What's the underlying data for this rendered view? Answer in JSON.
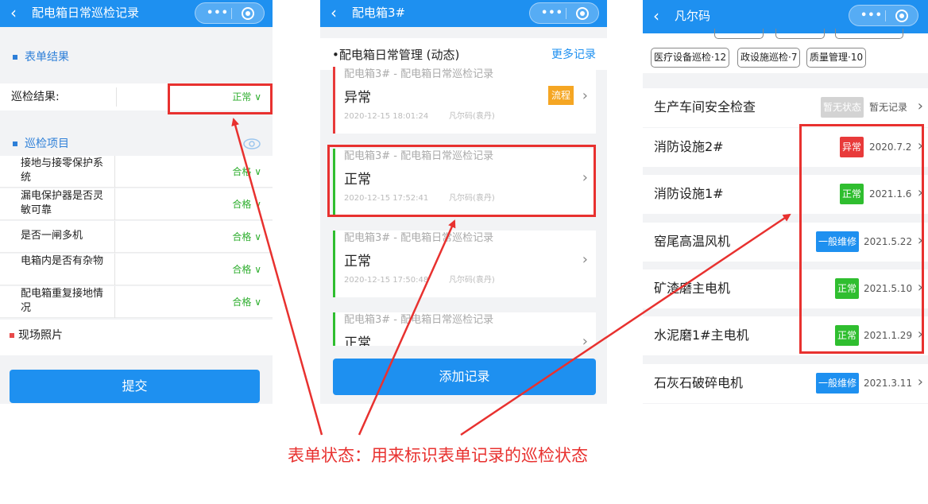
{
  "colors": {
    "nav": "#1e90f0",
    "ok": "#2fae2f",
    "bad": "#e83a3a",
    "orange": "#f5a623",
    "annot": "#e8312f"
  },
  "capsule": {
    "dots": "•••"
  },
  "p1": {
    "title": "配电箱日常巡检记录",
    "sec_result": "表单结果",
    "result_label": "巡检结果:",
    "result_value": "正常",
    "sec_items": "巡检项目",
    "items": [
      {
        "label": "接地与接零保护系统",
        "value": "合格"
      },
      {
        "label": "漏电保护器是否灵敏可靠",
        "value": "合格"
      },
      {
        "label": "是否一闸多机",
        "value": "合格"
      },
      {
        "label": "电箱内是否有杂物",
        "value": "合格"
      },
      {
        "label": "配电箱重复接地情况",
        "value": "合格"
      }
    ],
    "photos": "现场照片",
    "submit": "提交"
  },
  "p2": {
    "title": "配电箱3#",
    "section": "•配电箱日常管理 (动态)",
    "more": "更多记录",
    "cards": [
      {
        "title": "配电箱3# - 配电箱日常巡检记录",
        "status": "异常",
        "date": "2020-12-15 18:01:24",
        "user": "凡尔码(袁丹)",
        "flow": "流程"
      },
      {
        "title": "配电箱3# - 配电箱日常巡检记录",
        "status": "正常",
        "date": "2020-12-15 17:52:41",
        "user": "凡尔码(袁丹)"
      },
      {
        "title": "配电箱3# - 配电箱日常巡检记录",
        "status": "正常",
        "date": "2020-12-15 17:50:48",
        "user": "凡尔码(袁丹)"
      },
      {
        "title": "配电箱3# - 配电箱日常巡检记录",
        "status": "正常"
      }
    ],
    "add": "添加记录"
  },
  "p3": {
    "title": "凡尔码",
    "chips": [
      "医疗设备巡检·12",
      "政设施巡检·7",
      "质量管理·10"
    ],
    "rows": [
      {
        "name": "生产车间安全检查",
        "tag": "暂无状态",
        "date": "暂无记录",
        "tag_color": "#d3d3d3"
      },
      {
        "name": "消防设施2#",
        "tag": "异常",
        "date": "2020.7.2",
        "tag_color": "#e83a3a"
      },
      {
        "name": "消防设施1#",
        "tag": "正常",
        "date": "2021.1.6",
        "tag_color": "#2fbe2f"
      },
      {
        "name": "窑尾高温风机",
        "tag": "一般维修",
        "date": "2021.5.22",
        "tag_color": "#1e90f0"
      },
      {
        "name": "矿渣磨主电机",
        "tag": "正常",
        "date": "2021.5.10",
        "tag_color": "#2fbe2f"
      },
      {
        "name": "水泥磨1#主电机",
        "tag": "正常",
        "date": "2021.1.29",
        "tag_color": "#2fbe2f"
      },
      {
        "name": "石灰石破碎电机",
        "tag": "一般维修",
        "date": "2021.3.11",
        "tag_color": "#1e90f0"
      }
    ]
  },
  "caption": "表单状态：用来标识表单记录的巡检状态"
}
